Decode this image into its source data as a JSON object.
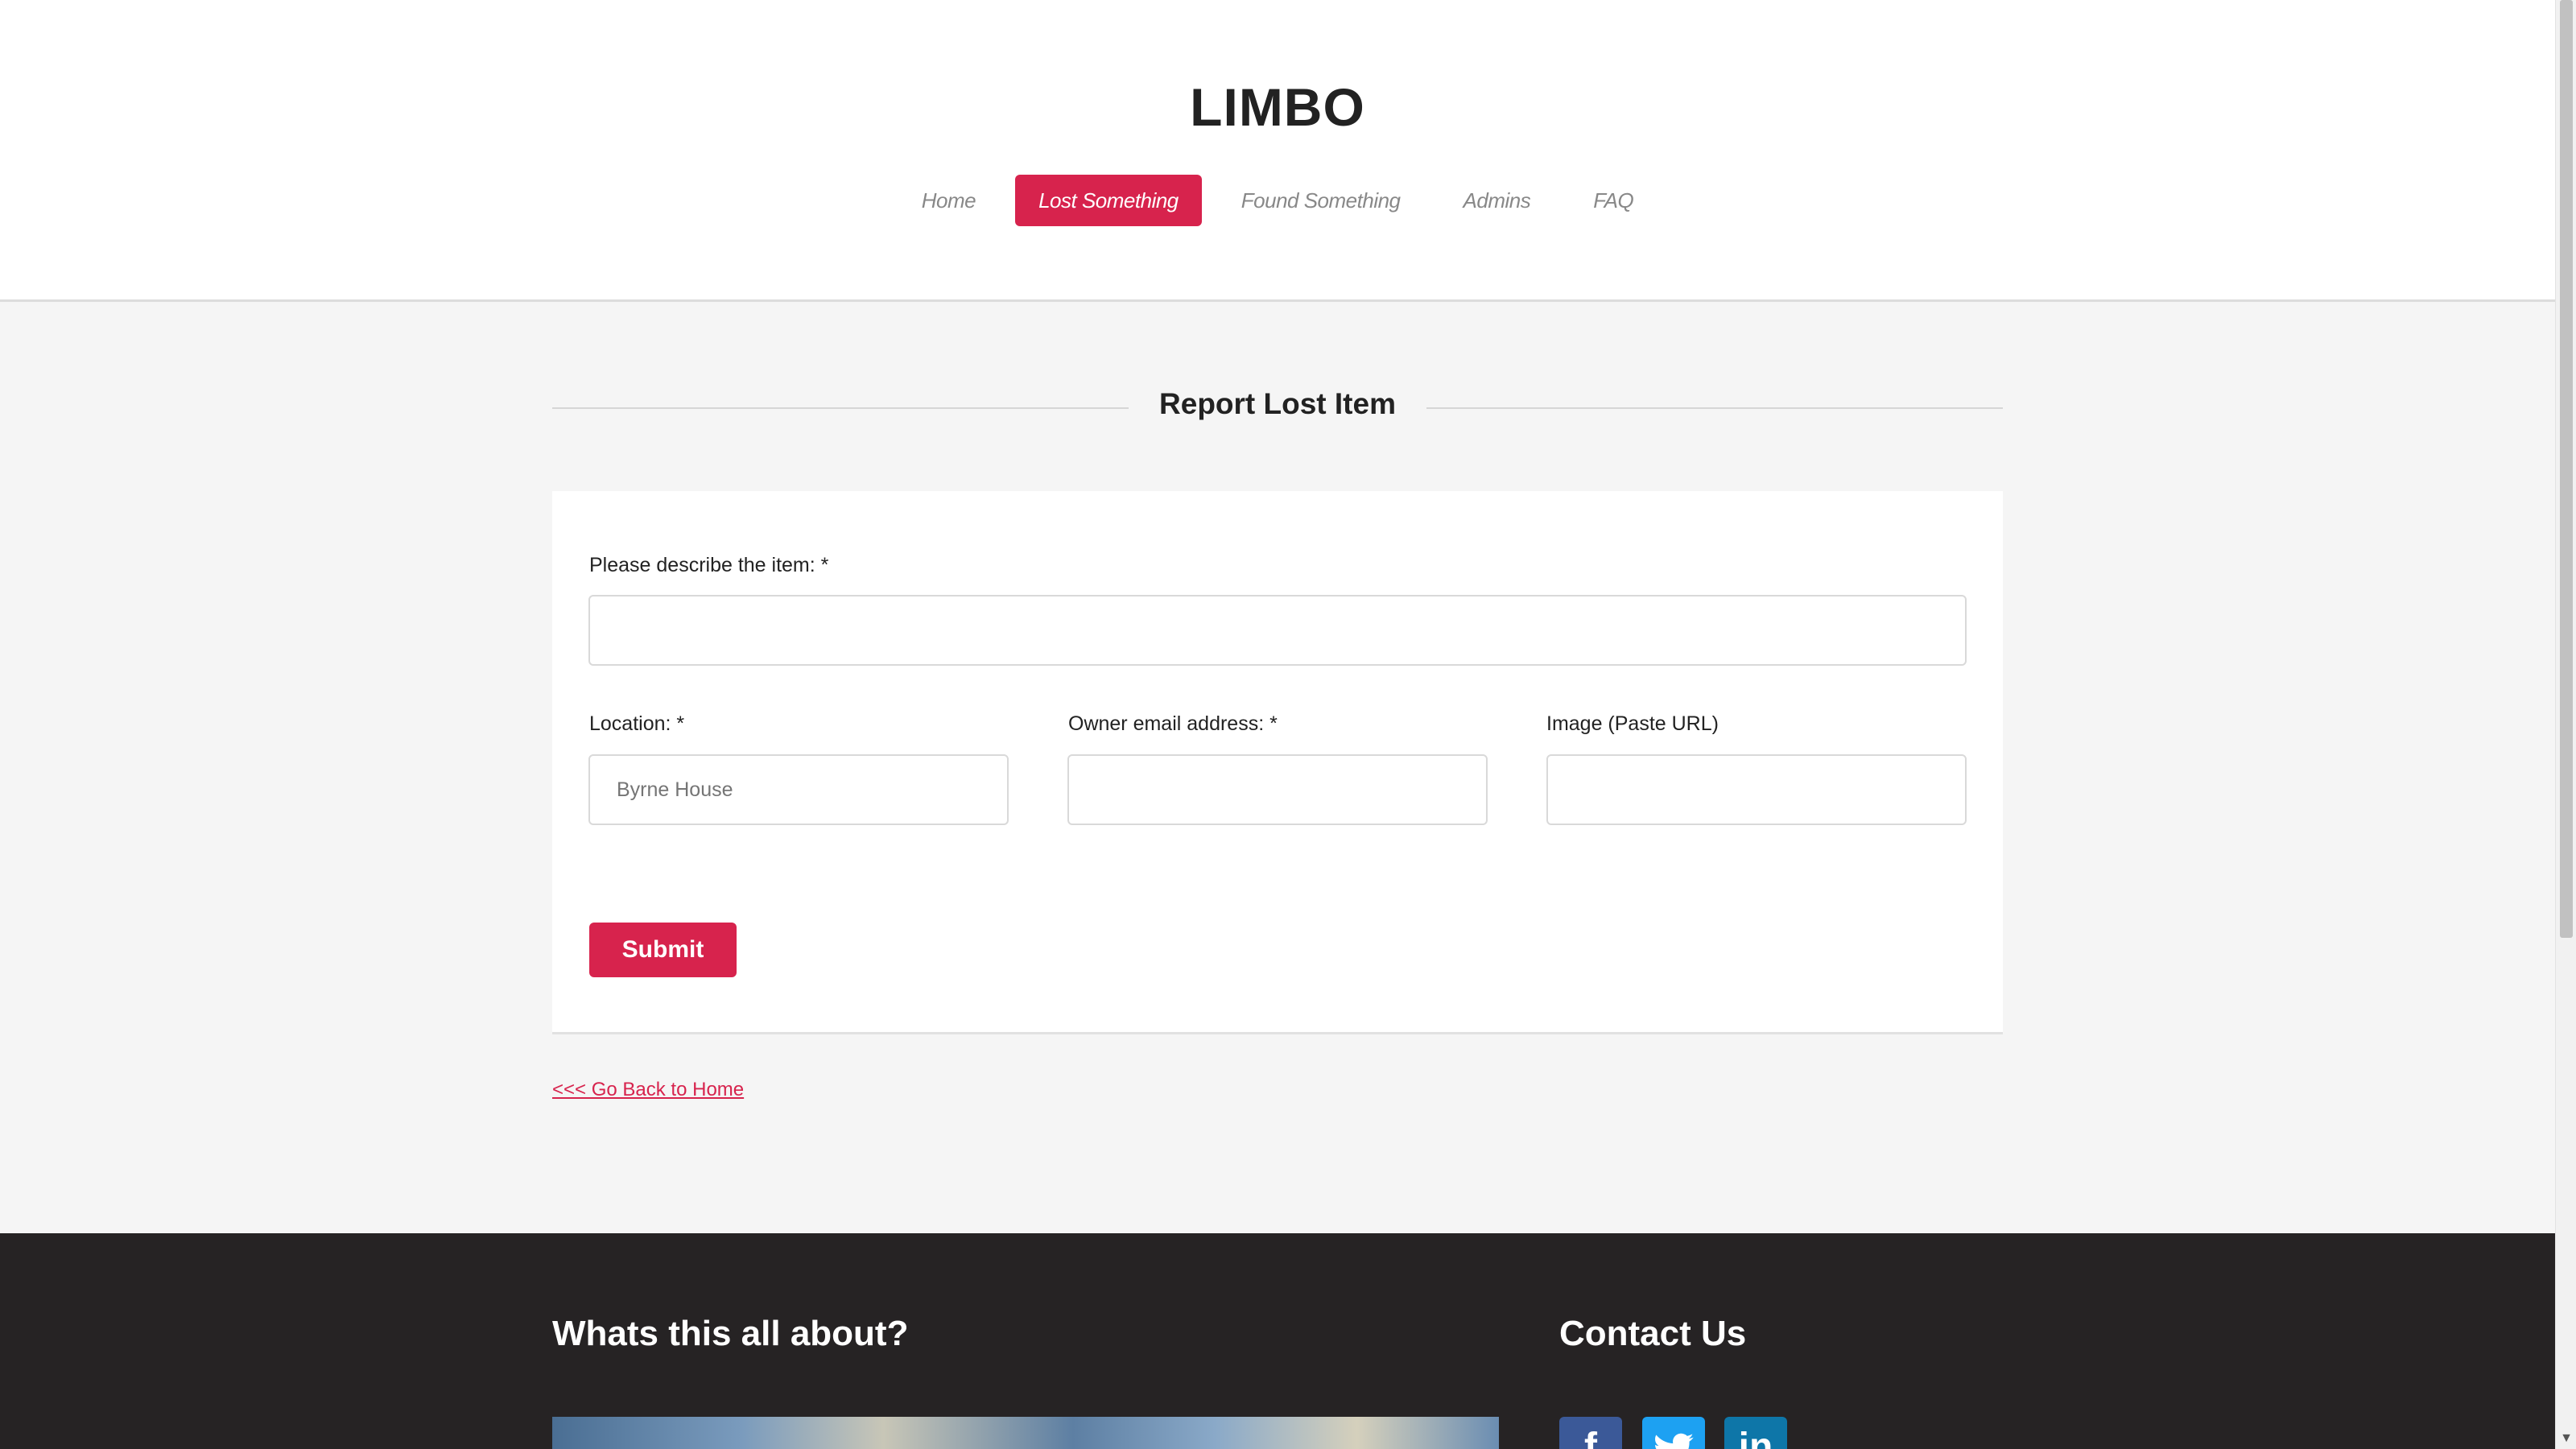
{
  "site": {
    "title": "LIMBO"
  },
  "nav": {
    "items": [
      {
        "label": "Home",
        "active": false
      },
      {
        "label": "Lost Something",
        "active": true
      },
      {
        "label": "Found Something",
        "active": false
      },
      {
        "label": "Admins",
        "active": false
      },
      {
        "label": "FAQ",
        "active": false
      }
    ]
  },
  "section": {
    "title": "Report Lost Item"
  },
  "form": {
    "description": {
      "label": "Please describe the item: *",
      "value": "",
      "placeholder": ""
    },
    "location": {
      "label": "Location: *",
      "value": "",
      "placeholder": "Byrne House"
    },
    "email": {
      "label": "Owner email address: *",
      "value": "",
      "placeholder": ""
    },
    "image": {
      "label": "Image (Paste URL)",
      "value": "",
      "placeholder": ""
    },
    "submit_label": "Submit"
  },
  "back_link": {
    "label": "<<< Go Back to Home"
  },
  "footer": {
    "about_title": "Whats this all about?",
    "contact_title": "Contact Us",
    "social_icons": [
      "facebook-icon",
      "twitter-icon",
      "linkedin-icon"
    ]
  },
  "colors": {
    "accent": "#d7234d",
    "footer_bg": "#262324",
    "page_bg": "#f5f5f5"
  }
}
